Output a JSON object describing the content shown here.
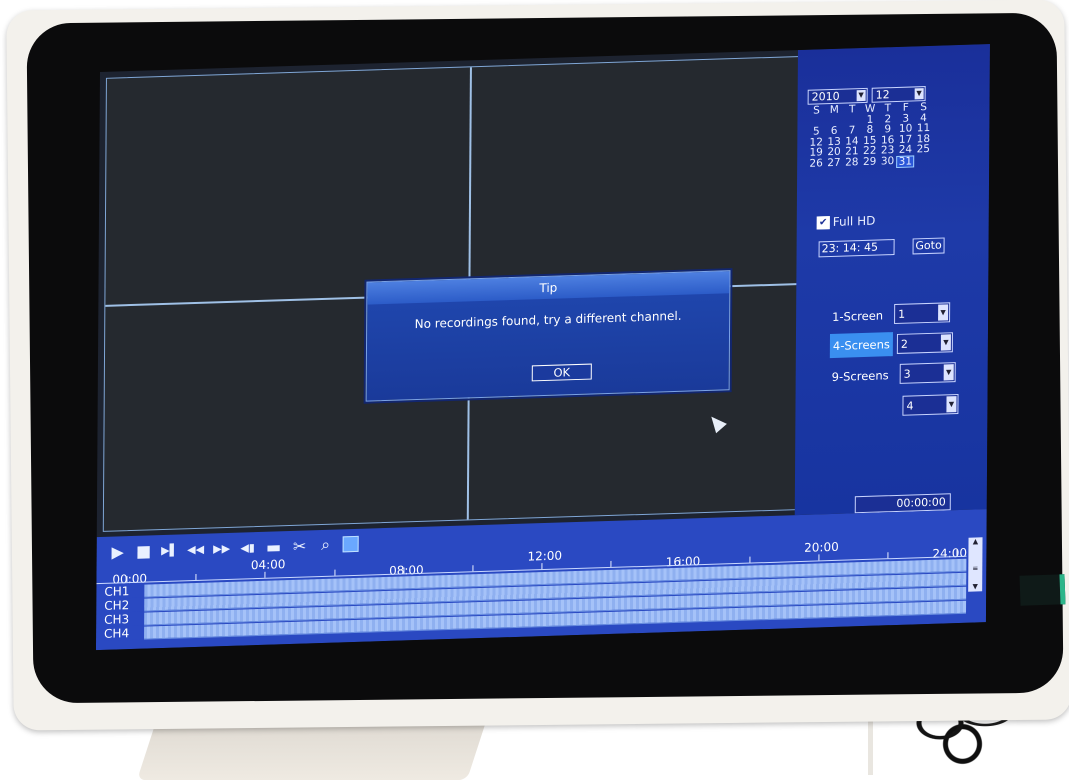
{
  "calendar": {
    "year": "2010",
    "month": "12",
    "weekdays": [
      "S",
      "M",
      "T",
      "W",
      "T",
      "F",
      "S"
    ],
    "weeks": [
      [
        "",
        "",
        "",
        "1",
        "2",
        "3",
        "4"
      ],
      [
        "5",
        "6",
        "7",
        "8",
        "9",
        "10",
        "11"
      ],
      [
        "12",
        "13",
        "14",
        "15",
        "16",
        "17",
        "18"
      ],
      [
        "19",
        "20",
        "21",
        "22",
        "23",
        "24",
        "25"
      ],
      [
        "26",
        "27",
        "28",
        "29",
        "30",
        "31",
        ""
      ]
    ],
    "selected_day": "31"
  },
  "options": {
    "full_hd_label": "Full HD",
    "full_hd_checked": true
  },
  "search": {
    "time_value": "23: 14: 45",
    "goto_label": "Goto"
  },
  "layout": {
    "modes": [
      {
        "label": "1-Screen",
        "active": false
      },
      {
        "label": "4-Screens",
        "active": true
      },
      {
        "label": "9-Screens",
        "active": false
      }
    ],
    "channels": [
      "1",
      "2",
      "3",
      "4"
    ]
  },
  "playback_time": "00:00:00",
  "dialog": {
    "title": "Tip",
    "message": "No recordings found, try a different channel.",
    "ok_label": "OK"
  },
  "timeline": {
    "ticks": [
      "00:00",
      "04:00",
      "08:00",
      "12:00",
      "16:00",
      "20:00",
      "24:00"
    ],
    "channels": [
      "CH1",
      "CH2",
      "CH3",
      "CH4"
    ]
  },
  "toolbar": [
    {
      "name": "play-icon",
      "glyph": "▶"
    },
    {
      "name": "stop-icon",
      "glyph": "■"
    },
    {
      "name": "step-forward-icon",
      "glyph": "▶▌"
    },
    {
      "name": "rewind-icon",
      "glyph": "◀◀"
    },
    {
      "name": "fast-forward-icon",
      "glyph": "▶▶"
    },
    {
      "name": "speaker-icon",
      "glyph": "◀▮"
    },
    {
      "name": "folder-icon",
      "glyph": "▬"
    },
    {
      "name": "scissors-icon",
      "glyph": "✂"
    },
    {
      "name": "zoom-icon",
      "glyph": "⌕"
    },
    {
      "name": "record-icon",
      "glyph": ""
    }
  ]
}
